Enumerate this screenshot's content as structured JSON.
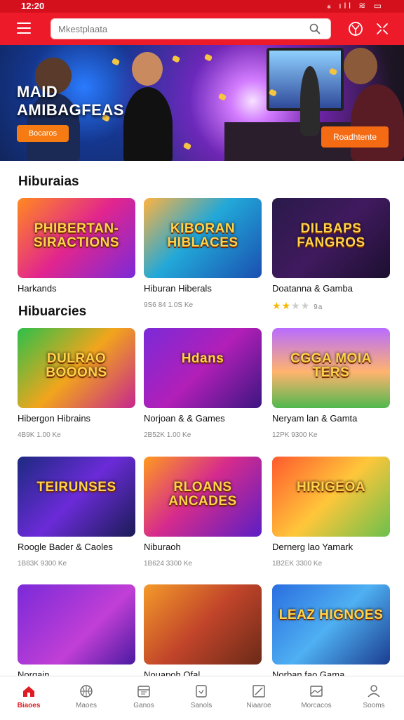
{
  "status": {
    "time": "12:20",
    "icons": "⁎ ıll ≋ ▭"
  },
  "search": {
    "placeholder": "Mkestplaata"
  },
  "banner": {
    "title_line1": "MAID",
    "title_line2": "AMIBAGFEAS",
    "left_button": "Bocaros",
    "right_button": "Roadhtente"
  },
  "sections": [
    {
      "title": "Hiburaias"
    },
    {
      "title": "Hibuarcies"
    }
  ],
  "cards": [
    {
      "art": "PHIBERTAN- SIRACTIONS",
      "name": "Harkands",
      "meta": "",
      "gradient": "linear-gradient(135deg,#ff8a1f 0%,#e2258e 50%,#7b2ad8 100%)"
    },
    {
      "art": "KIBORAN HIBLACES",
      "name": "Hiburan Hiberals",
      "meta": "9S6 84 1.0S Ke",
      "gradient": "linear-gradient(135deg,#ffb340 0%,#22a8d8 45%,#1a4fb0 100%)"
    },
    {
      "art": "DILBAPS FANGROS",
      "name": "Doatanna & Gamba",
      "meta": "",
      "rating": "9a",
      "gradient": "linear-gradient(135deg,#2a1a4a 0%,#401a5e 50%,#1c0f30 100%)"
    },
    {
      "art": "DULRAO BOOONS",
      "name": "Hibergon Hibrains",
      "meta": "4B9K 1.00 Ke",
      "gradient": "linear-gradient(135deg,#2cc04a 0%,#f2a51c 50%,#c6268d 100%)"
    },
    {
      "art": "Hdans",
      "name": "Norjoan & & Games",
      "meta": "2B52K 1.00 Ke",
      "gradient": "linear-gradient(135deg,#7b2ad8 0%,#b21fb8 50%,#3c1680 100%)"
    },
    {
      "art": "CGGA MOIA TERS",
      "name": "Neryam lan & Gamta",
      "meta": "12PK 9300 Ke",
      "gradient": "linear-gradient(180deg,#b86cff 0%,#ffb46e 55%,#4fb84e 100%)"
    },
    {
      "art": "TEIRUNSES",
      "name": "Roogle Bader & Caoles",
      "meta": "1B83K 9300 Ke",
      "gradient": "linear-gradient(135deg,#1c2a80 0%,#6b2bd8 50%,#1a1c55 100%)"
    },
    {
      "art": "RLOANS ANCADES",
      "name": "Niburaoh",
      "meta": "1B624 3300 Ke",
      "gradient": "linear-gradient(135deg,#ff9a1f 0%,#d62b8c 45%,#5b1ec4 100%)"
    },
    {
      "art": "HIRIGEOA",
      "name": "Dernerg lao Yamark",
      "meta": "1B2EK 3300 Ke",
      "gradient": "linear-gradient(135deg,#ff5a2e 0%,#ffc63a 50%,#6bc04c 100%)"
    },
    {
      "art": "",
      "name": "Norgain",
      "meta": "",
      "gradient": "linear-gradient(135deg,#7a2ad8 0%,#c13fd6 60%,#4a1aa0 100%)"
    },
    {
      "art": "",
      "name": "Nouapoh Ofal",
      "meta": "",
      "gradient": "linear-gradient(135deg,#f49a2a 0%,#c1442a 50%,#6a2a18 100%)"
    },
    {
      "art": "LEAZ HIGNOES",
      "name": "Norban fao Gama",
      "meta": "",
      "gradient": "linear-gradient(135deg,#2a6ee0 0%,#4fb0f2 50%,#1b3d90 100%)"
    }
  ],
  "bottom_nav": [
    {
      "label": "Biaoes",
      "icon": "home-icon",
      "active": true
    },
    {
      "label": "Maoes",
      "icon": "basketball-icon",
      "active": false
    },
    {
      "label": "Ganos",
      "icon": "calendar-icon",
      "active": false
    },
    {
      "label": "Sanols",
      "icon": "tag-icon",
      "active": false
    },
    {
      "label": "Niaaroe",
      "icon": "edit-icon",
      "active": false
    },
    {
      "label": "Morcacos",
      "icon": "image-icon",
      "active": false
    },
    {
      "label": "Sooms",
      "icon": "user-icon",
      "active": false
    }
  ],
  "colors": {
    "brand": "#ed1b2a",
    "accent": "#f57b12",
    "nav_active": "#e01b24"
  }
}
